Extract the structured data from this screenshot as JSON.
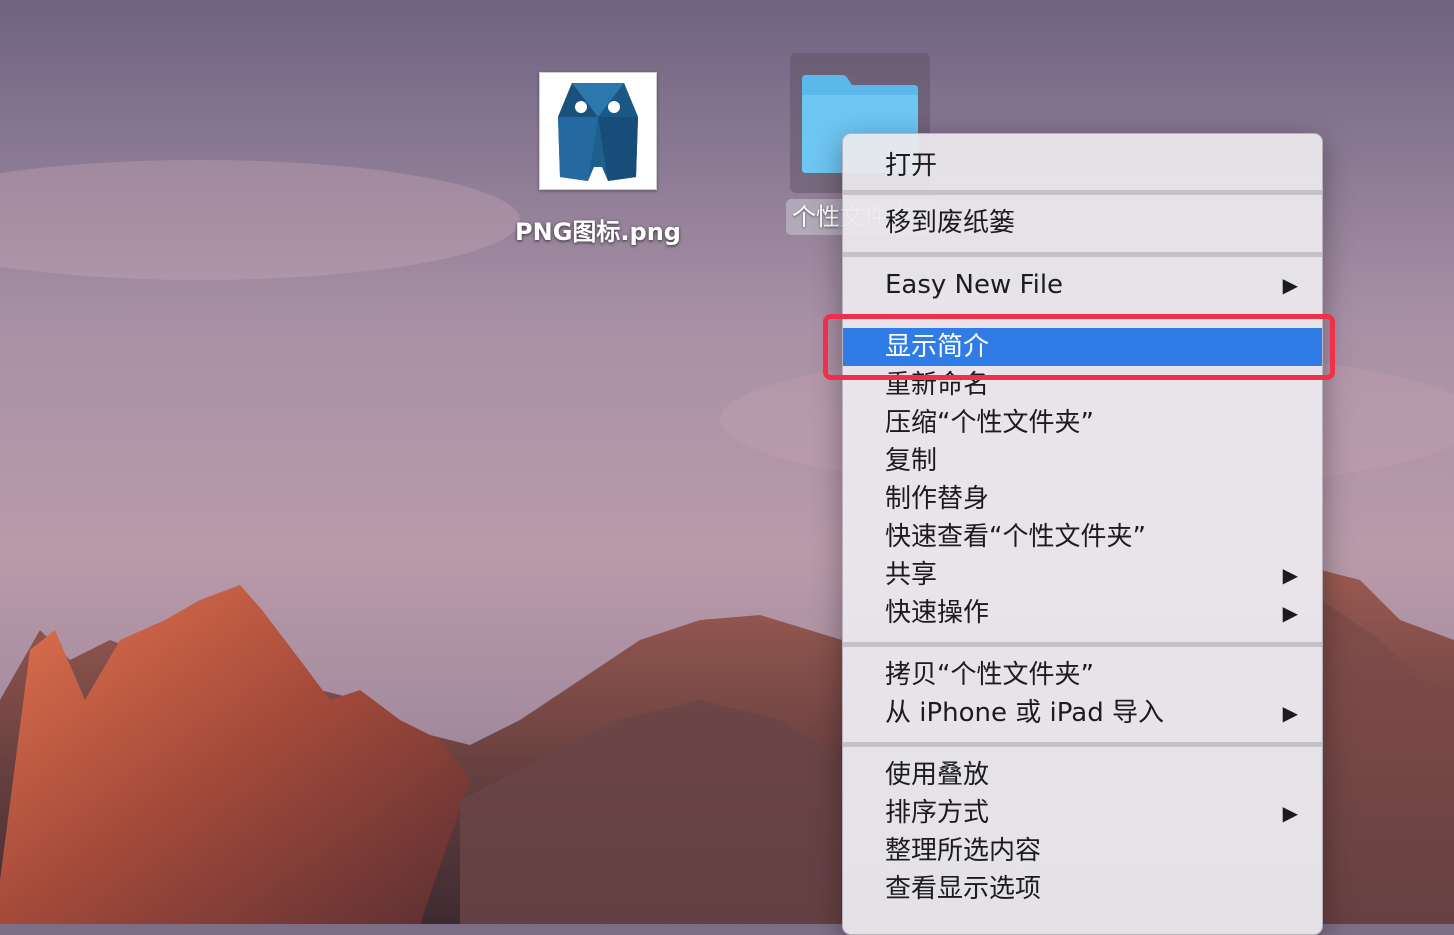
{
  "desktop": {
    "icons": [
      {
        "label": "PNG图标.png",
        "icon": "robot-image-icon"
      },
      {
        "label": "个性文件夹",
        "icon": "folder-icon"
      }
    ]
  },
  "context_menu": {
    "groups": [
      {
        "items": [
          {
            "label": "打开"
          }
        ]
      },
      {
        "items": [
          {
            "label": "移到废纸篓"
          }
        ]
      },
      {
        "items": [
          {
            "label": "Easy New File",
            "submenu": true
          }
        ]
      },
      {
        "items": [
          {
            "label": "显示简介",
            "highlighted": true
          },
          {
            "label": "重新命名"
          },
          {
            "label": "压缩“个性文件夹”"
          },
          {
            "label": "复制"
          },
          {
            "label": "制作替身"
          },
          {
            "label": "快速查看“个性文件夹”"
          },
          {
            "label": "共享",
            "submenu": true
          },
          {
            "label": "快速操作",
            "submenu": true
          }
        ]
      },
      {
        "items": [
          {
            "label": "拷贝“个性文件夹”"
          },
          {
            "label": "从 iPhone 或 iPad 导入",
            "submenu": true
          }
        ]
      },
      {
        "items": [
          {
            "label": "使用叠放"
          },
          {
            "label": "排序方式",
            "submenu": true
          },
          {
            "label": "整理所选内容"
          },
          {
            "label": "查看显示选项"
          }
        ]
      }
    ],
    "submenu_arrow": "▶",
    "highlight_color": "#2f7ce6",
    "annotation_color": "#f0304a"
  }
}
